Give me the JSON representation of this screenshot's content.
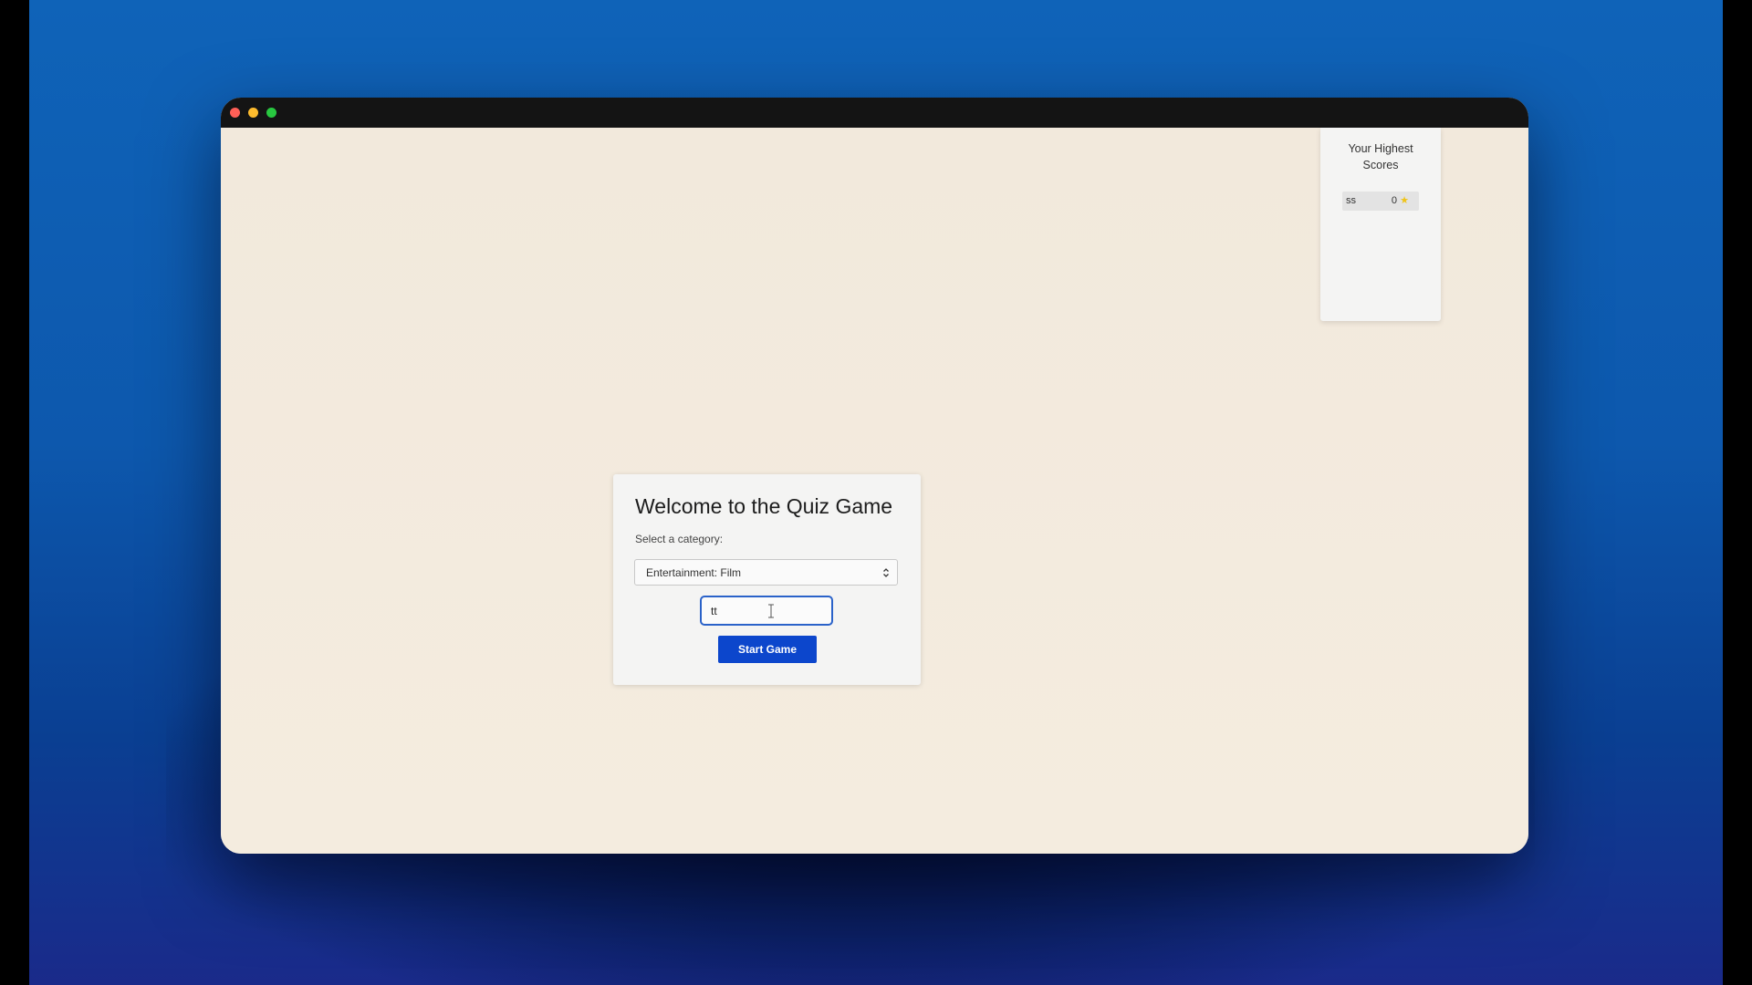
{
  "scores": {
    "title": "Your Highest Scores",
    "entries": [
      {
        "name": "ss",
        "score": "0",
        "icon": "star-icon"
      }
    ]
  },
  "quiz": {
    "title": "Welcome to the Quiz Game",
    "category_label": "Select a category:",
    "category_selected": "Entertainment: Film",
    "name_value": "tt",
    "start_label": "Start Game"
  },
  "colors": {
    "accent": "#0c46cc",
    "input_focus": "#2a62c9",
    "star": "#f0c419",
    "page_background": "#f3ebdf"
  }
}
